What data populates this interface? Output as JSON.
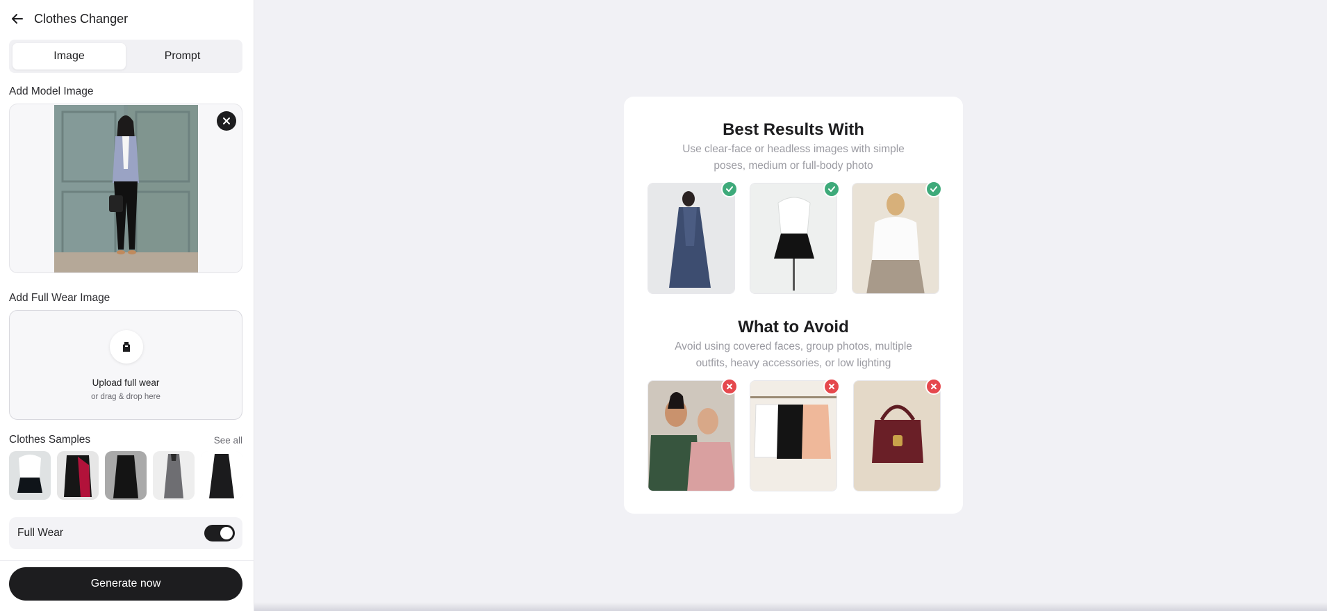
{
  "header": {
    "title": "Clothes Changer"
  },
  "tabs": [
    {
      "label": "Image",
      "active": true
    },
    {
      "label": "Prompt",
      "active": false
    }
  ],
  "model_section": {
    "label": "Add Model Image"
  },
  "full_wear_section": {
    "label": "Add Full Wear Image",
    "upload_title": "Upload full wear",
    "upload_subtitle": "or drag & drop here"
  },
  "samples": {
    "title": "Clothes Samples",
    "see_all": "See all"
  },
  "full_wear_toggle": {
    "label": "Full Wear",
    "on": true
  },
  "generate_button": {
    "label": "Generate now"
  },
  "best_results": {
    "title": "Best Results With",
    "subtitle": "Use clear-face or headless images with simple poses, medium or full-body photo"
  },
  "avoid": {
    "title": "What to Avoid",
    "subtitle": "Avoid using covered faces, group photos, multiple outfits, heavy accessories, or low lighting"
  },
  "colors": {
    "accent": "#1d1d1f",
    "ok_badge": "#3eaa7a",
    "no_badge": "#e5484d",
    "background": "#f1f1f5"
  },
  "icons": {
    "back": "arrow-left-icon",
    "close": "close-icon",
    "upload": "garment-icon",
    "ok": "check-icon",
    "no": "x-icon"
  }
}
